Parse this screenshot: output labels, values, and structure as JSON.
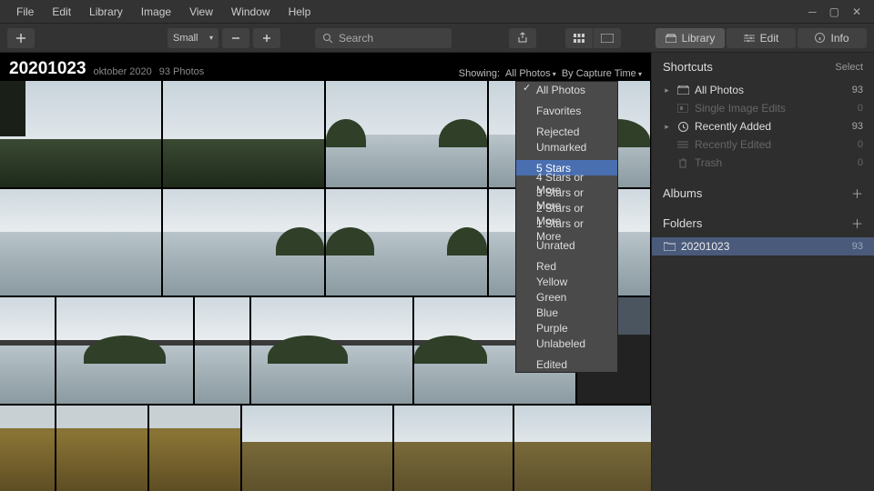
{
  "menu": {
    "items": [
      "File",
      "Edit",
      "Library",
      "Image",
      "View",
      "Window",
      "Help"
    ]
  },
  "toolbar": {
    "zoom_label": "Small",
    "search_placeholder": "Search"
  },
  "panels": {
    "library": "Library",
    "edit": "Edit",
    "info": "Info"
  },
  "browser": {
    "title": "20201023",
    "subtitle1": "oktober 2020",
    "subtitle2": "93 Photos",
    "showing_label": "Showing:",
    "filter": "All Photos",
    "sort": "By Capture Time"
  },
  "filter_menu": {
    "groups": [
      [
        "All Photos"
      ],
      [
        "Favorites"
      ],
      [
        "Rejected",
        "Unmarked"
      ],
      [
        "5 Stars",
        "4 Stars or More",
        "3 Stars or More",
        "2 Stars or More",
        "1 Stars or More",
        "Unrated"
      ],
      [
        "Red",
        "Yellow",
        "Green",
        "Blue",
        "Purple",
        "Unlabeled"
      ],
      [
        "Edited"
      ]
    ],
    "checked": "All Photos",
    "highlighted": "5 Stars"
  },
  "sidebar": {
    "shortcuts": {
      "title": "Shortcuts",
      "action": "Select",
      "rows": [
        {
          "label": "All Photos",
          "count": "93",
          "dim": false,
          "icon": "photos"
        },
        {
          "label": "Single Image Edits",
          "count": "0",
          "dim": true,
          "icon": "single"
        },
        {
          "label": "Recently Added",
          "count": "93",
          "dim": false,
          "icon": "clock"
        },
        {
          "label": "Recently Edited",
          "count": "0",
          "dim": true,
          "icon": "sliders"
        },
        {
          "label": "Trash",
          "count": "0",
          "dim": true,
          "icon": "trash"
        }
      ]
    },
    "albums": {
      "title": "Albums"
    },
    "folders": {
      "title": "Folders",
      "rows": [
        {
          "label": "20201023",
          "count": "93"
        }
      ]
    }
  }
}
